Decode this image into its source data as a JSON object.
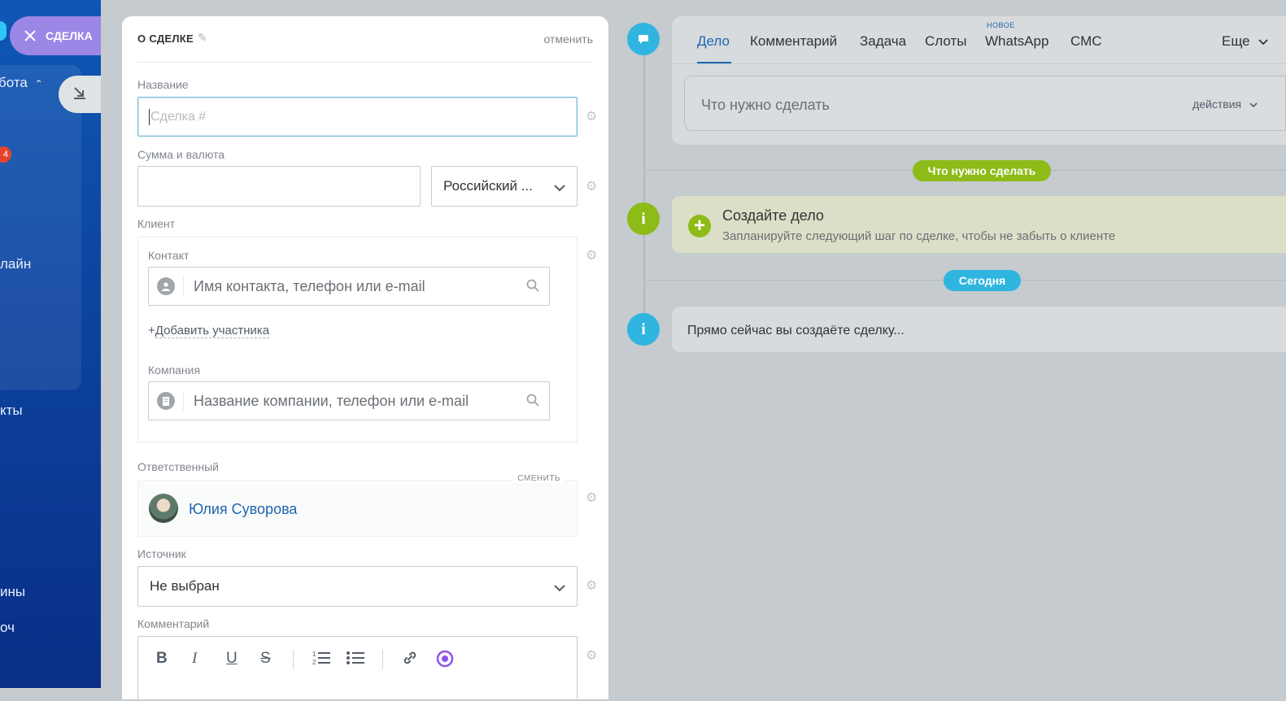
{
  "sidebar": {
    "items": [
      {
        "label": "бота"
      },
      {
        "label": "лайн"
      },
      {
        "label": "кты"
      },
      {
        "label": "ины"
      },
      {
        "label": "оч"
      }
    ],
    "badge": "4"
  },
  "close_pill": {
    "label": "СДЕЛКА"
  },
  "form": {
    "title": "О СДЕЛКЕ",
    "cancel": "отменить",
    "name_label": "Название",
    "name_placeholder": "Сделка #",
    "sum_label": "Сумма и валюта",
    "currency": "Российский ...",
    "client_label": "Клиент",
    "contact_label": "Контакт",
    "contact_placeholder": "Имя контакта, телефон или e-mail",
    "add_participant": "Добавить участника",
    "company_label": "Компания",
    "company_placeholder": "Название компании, телефон или e-mail",
    "responsible_label": "Ответственный",
    "responsible_change": "СМЕНИТЬ",
    "responsible_name": "Юлия Суворова",
    "source_label": "Источник",
    "source_value": "Не выбран",
    "comment_label": "Комментарий"
  },
  "editor_toolbar": {
    "bold": "B",
    "italic": "I",
    "underline": "U",
    "strike": "S"
  },
  "timeline": {
    "tabs": [
      {
        "label": "Дело"
      },
      {
        "label": "Комментарий"
      },
      {
        "label": "Задача"
      },
      {
        "label": "Слоты"
      },
      {
        "label": "WhatsApp"
      },
      {
        "label": "СМС"
      }
    ],
    "new_badge": "НОВОЕ",
    "more": "Еще",
    "todo_placeholder": "Что нужно сделать",
    "actions": "действия",
    "todo_pill": "Что нужно сделать",
    "create_title": "Создайте дело",
    "create_sub": "Запланируйте следующий шаг по сделке, чтобы не забыть о клиенте",
    "today_pill": "Сегодня",
    "now_text": "Прямо сейчас вы создаёте сделку..."
  },
  "colors": {
    "accent_blue": "#2067b0",
    "timeline_cyan": "#2fb5e0",
    "timeline_green": "#8dbb17",
    "pill_purple": "#9c86e6"
  }
}
